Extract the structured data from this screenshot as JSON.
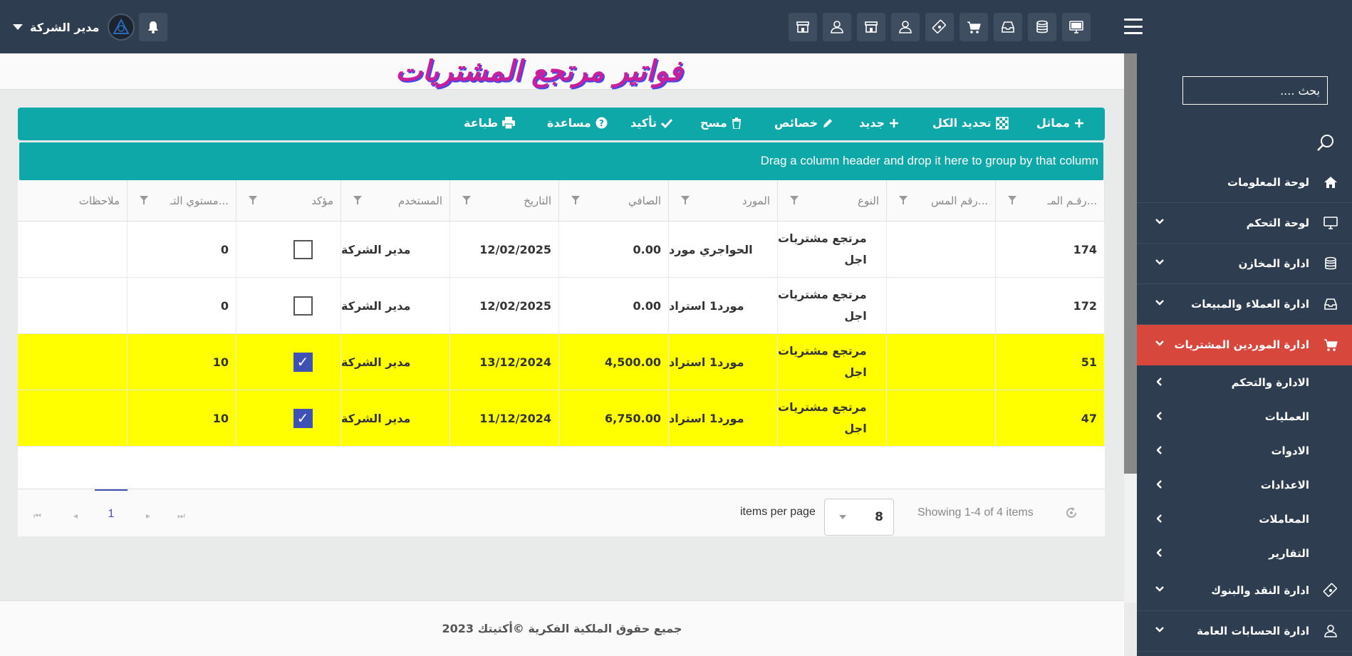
{
  "header": {
    "user_name": "مدير الشركة",
    "top_icons": [
      "store-icon",
      "user-icon",
      "store-icon",
      "user-icon",
      "money-icon",
      "cart-icon",
      "inbox-icon",
      "database-icon",
      "monitor-icon"
    ]
  },
  "sidebar": {
    "search_placeholder": "بحث ....",
    "items": [
      {
        "label": "لوحة المعلومات",
        "icon": "home-icon"
      },
      {
        "label": "لوحة التحكم",
        "icon": "monitor-icon"
      },
      {
        "label": "ادارة المخازن",
        "icon": "database-icon"
      },
      {
        "label": "ادارة العملاء والمبيعات",
        "icon": "inbox-icon"
      },
      {
        "label": "ادارة الموردين المشتريات",
        "icon": "cart-icon",
        "active": true
      },
      {
        "label": "ادارة النقد والبنوك",
        "icon": "money-icon"
      },
      {
        "label": "ادارة الحسابات العامة",
        "icon": "user-icon"
      }
    ],
    "subitems": [
      {
        "label": "الادارة والتحكم"
      },
      {
        "label": "العمليات"
      },
      {
        "label": "الادوات"
      },
      {
        "label": "الاعدادات"
      },
      {
        "label": "المعاملات"
      },
      {
        "label": "التقارير"
      }
    ]
  },
  "page": {
    "title": "فواتير مرتجع المشتريات"
  },
  "toolbar": {
    "similar": "مماثل",
    "select_all": "تحديد الكل",
    "new": "جديد",
    "properties": "خصائص",
    "delete": "مسح",
    "confirm": "تأكيد",
    "help": "مساعدة",
    "print": "طباعة"
  },
  "grid": {
    "group_hint": "Drag a column header and drop it here to group by that column",
    "columns": [
      "رقـم المـ...",
      "رقم المس...",
      "النوع",
      "المورد",
      "الصافي",
      "التاريخ",
      "المستخدم",
      "مؤكد",
      "مستوي التـ...",
      "ملاحظات"
    ],
    "rows": [
      {
        "no": "174",
        "ref": "",
        "type": "مرتجع مشتريات\nاجل",
        "supplier": "الحواجري مورد",
        "net": "0.00",
        "date": "12/02/2025",
        "user": "مدير الشركة",
        "confirmed": false,
        "level": "0",
        "notes": "",
        "highlight": false
      },
      {
        "no": "172",
        "ref": "",
        "type": "مرتجع مشتريات\nاجل",
        "supplier": "مورد1 استراد",
        "net": "0.00",
        "date": "12/02/2025",
        "user": "مدير الشركة",
        "confirmed": false,
        "level": "0",
        "notes": "",
        "highlight": false
      },
      {
        "no": "51",
        "ref": "",
        "type": "مرتجع مشتريات\nاجل",
        "supplier": "مورد1 استراد",
        "net": "4,500.00",
        "date": "13/12/2024",
        "user": "مدير الشركة",
        "confirmed": true,
        "level": "10",
        "notes": "",
        "highlight": true
      },
      {
        "no": "47",
        "ref": "",
        "type": "مرتجع مشتريات\nاجل",
        "supplier": "مورد1 استراد",
        "net": "6,750.00",
        "date": "11/12/2024",
        "user": "مدير الشركة",
        "confirmed": true,
        "level": "10",
        "notes": "",
        "highlight": true
      }
    ]
  },
  "pager": {
    "current_page": "1",
    "items_per_page_label": "items per page",
    "items_per_page": "8",
    "showing": "Showing 1-4 of 4 items"
  },
  "footer": {
    "text": "جميع حقوق الملكية الفكرية ©أكتيتك 2023"
  },
  "colors": {
    "topbar": "#2e3e50",
    "accent": "#0fa8a8",
    "active_menu": "#d8473b",
    "highlight_row": "#ffff00",
    "checkbox": "#3f51b5"
  }
}
